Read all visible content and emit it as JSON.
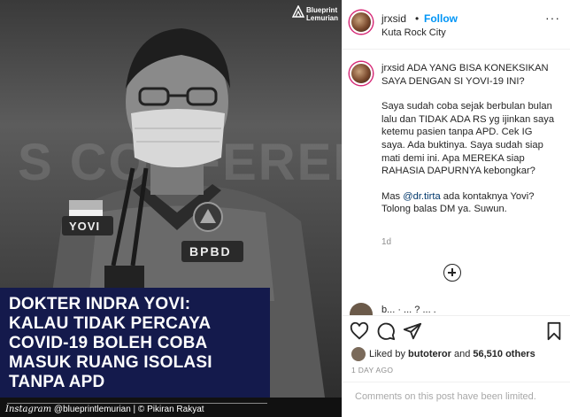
{
  "photo": {
    "background_word": "S CONFERENCE",
    "vest_name": "YOVI",
    "vest_badge": "BPBD",
    "watermark": {
      "line1": "Blueprint",
      "line2": "Lemurian"
    },
    "headline_lines": [
      "DOKTER INDRA YOVI:",
      "KALAU TIDAK PERCAYA",
      "COVID-19 BOLEH COBA",
      "MASUK RUANG ISOLASI",
      "TANPA APD"
    ],
    "credit_script": "Instagram",
    "credit_text": "@blueprintlemurian | © Pikiran Rakyat"
  },
  "header": {
    "username": "jrxsid",
    "dot": "•",
    "follow_label": "Follow",
    "location": "Kuta Rock City",
    "more_label": "···"
  },
  "caption": {
    "username": "jrxsid",
    "first_line": "ADA YANG BISA KONEKSIKAN SAYA DENGAN SI YOVI-19 INI?",
    "paragraph2": "Saya sudah coba sejak berbulan bulan lalu dan TIDAK ADA RS yg ijinkan saya ketemu pasien tanpa APD. Cek IG saya. Ada buktinya. Saya sudah siap mati demi ini. Apa MEREKA siap RAHASIA DAPURNYA kebongkar?",
    "p3_before": "Mas ",
    "p3_mention": "@dr.tirta",
    "p3_after": " ada kontaknya Yovi? Tolong balas DM ya. Suwun.",
    "time": "1d"
  },
  "comment_peek": {
    "text": "b... · ... ? ... ."
  },
  "actions": {
    "icons": [
      "heart-icon",
      "comment-icon",
      "share-icon",
      "bookmark-icon"
    ],
    "liked_by_prefix": "Liked by ",
    "liked_by_user": "butoteror",
    "liked_by_mid": " and ",
    "likes_count": "56,510 others",
    "post_time": "1 DAY AGO"
  },
  "comments_limited": "Comments on this post have been limited."
}
